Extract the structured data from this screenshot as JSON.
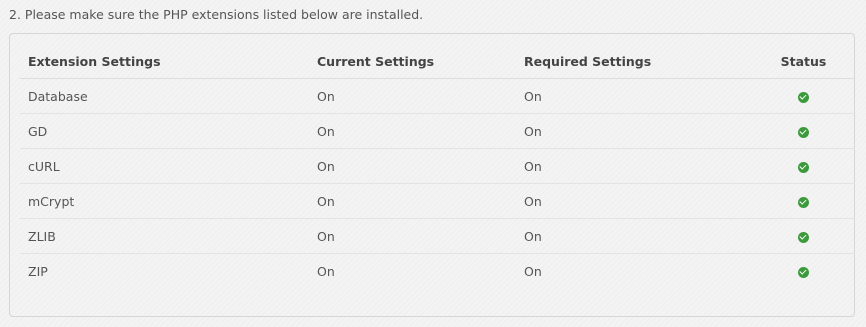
{
  "intro": "2. Please make sure the PHP extensions listed below are installed.",
  "table": {
    "headers": {
      "extension": "Extension Settings",
      "current": "Current Settings",
      "required": "Required Settings",
      "status": "Status"
    },
    "rows": [
      {
        "name": "Database",
        "current": "On",
        "required": "On",
        "status_icon": "check-circle-icon"
      },
      {
        "name": "GD",
        "current": "On",
        "required": "On",
        "status_icon": "check-circle-icon"
      },
      {
        "name": "cURL",
        "current": "On",
        "required": "On",
        "status_icon": "check-circle-icon"
      },
      {
        "name": "mCrypt",
        "current": "On",
        "required": "On",
        "status_icon": "check-circle-icon"
      },
      {
        "name": "ZLIB",
        "current": "On",
        "required": "On",
        "status_icon": "check-circle-icon"
      },
      {
        "name": "ZIP",
        "current": "On",
        "required": "On",
        "status_icon": "check-circle-icon"
      }
    ]
  },
  "colors": {
    "status_ok": "#3c9a3c",
    "border": "#d6d6d6"
  }
}
